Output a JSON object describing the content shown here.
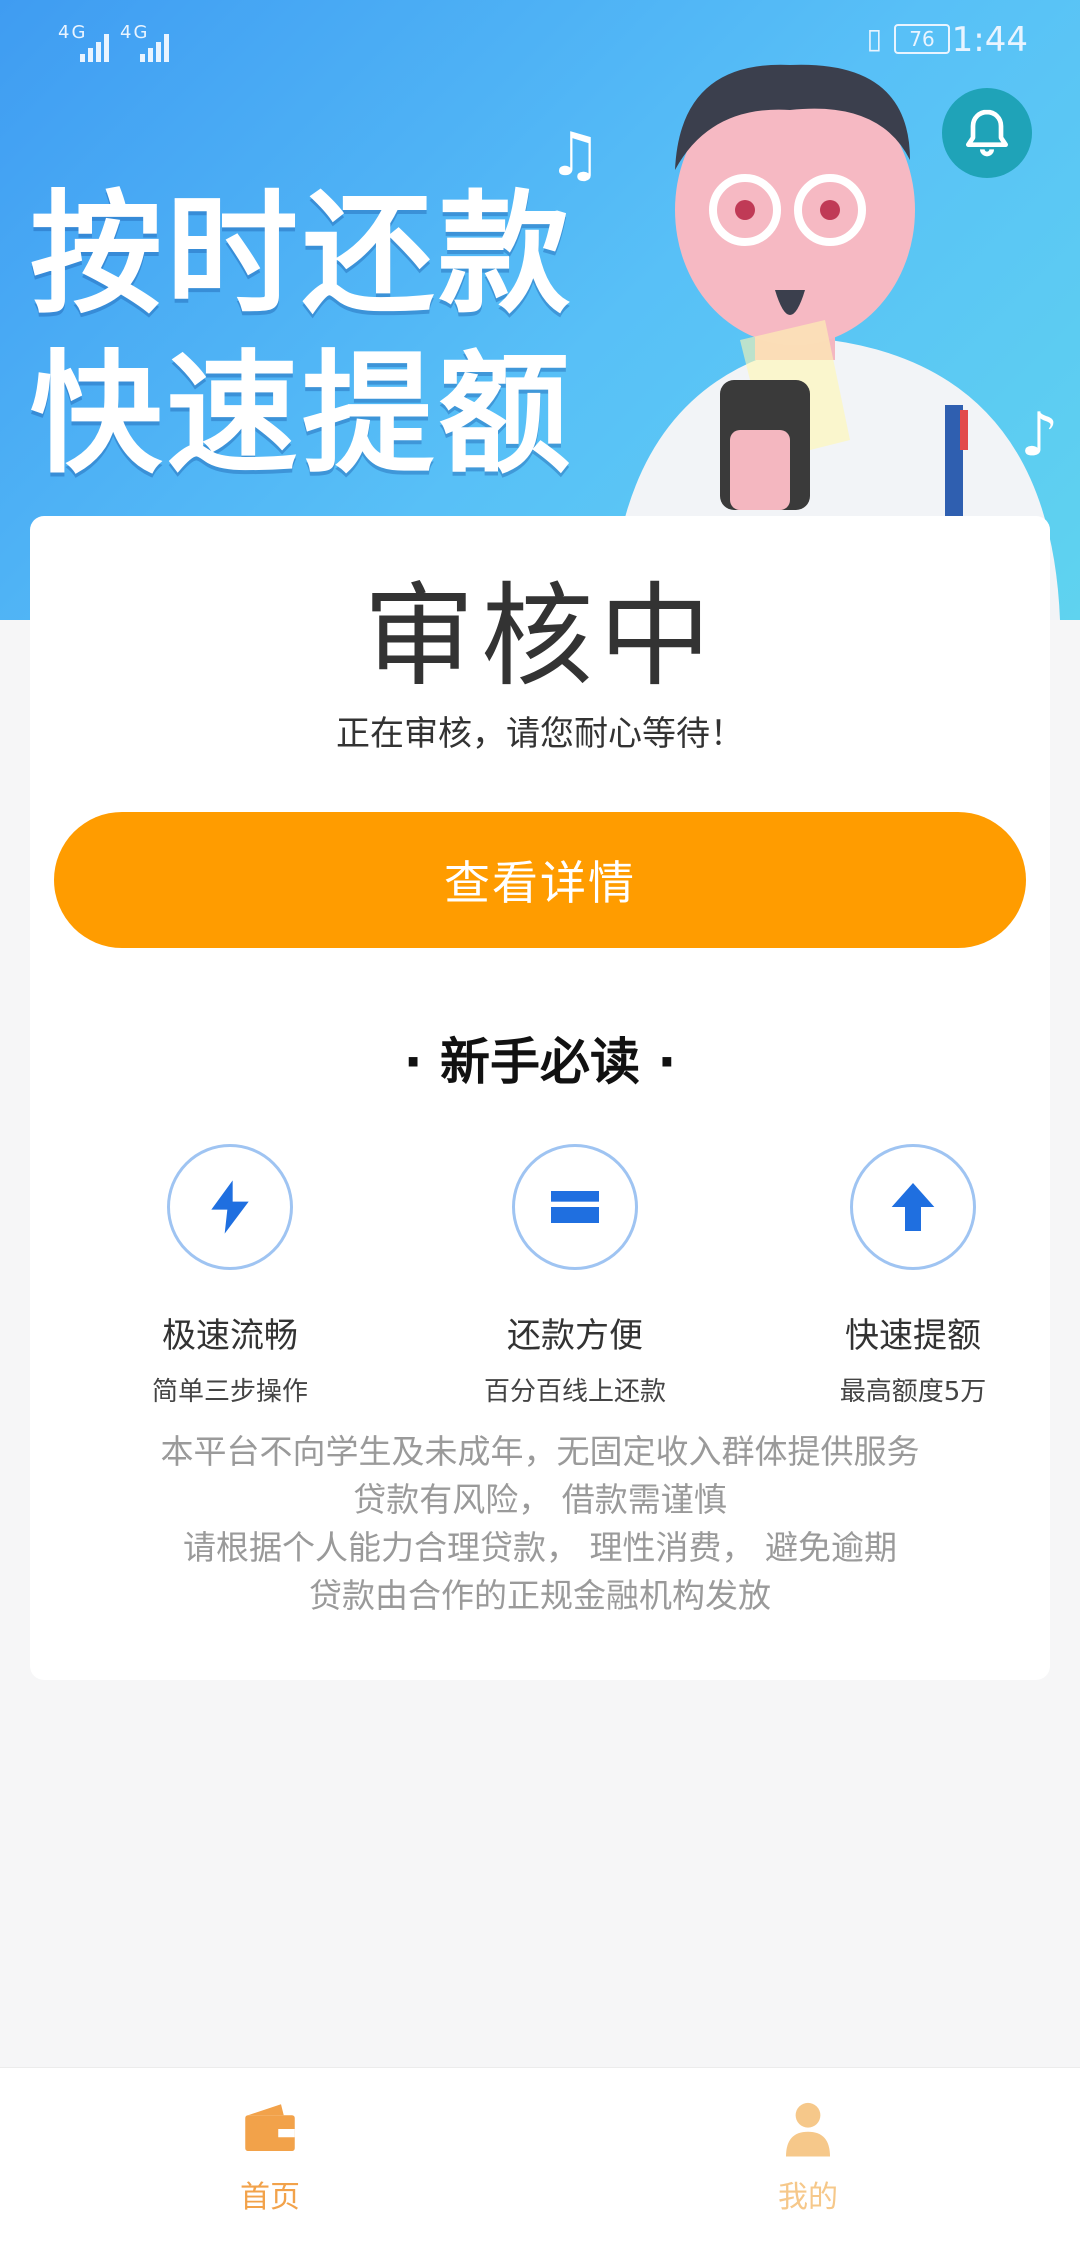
{
  "status_bar": {
    "signal_1": "4G",
    "signal_2": "4G",
    "battery": "76",
    "time": "1:44"
  },
  "banner": {
    "line1": "按时还款",
    "line2": "快速提额"
  },
  "card": {
    "status_title": "审核中",
    "status_subtitle": "正在审核，请您耐心等待！",
    "detail_button": "查看详情",
    "section_title": "· 新手必读 ·",
    "features": [
      {
        "name": "极速流畅",
        "desc": "简单三步操作",
        "icon": "lightning-icon"
      },
      {
        "name": "还款方便",
        "desc": "百分百线上还款",
        "icon": "card-icon"
      },
      {
        "name": "快速提额",
        "desc": "最高额度5万",
        "icon": "arrow-up-icon"
      }
    ],
    "notice_lines": [
      "本平台不向学生及未成年，无固定收入群体提供服务",
      "贷款有风险， 借款需谨慎",
      "请根据个人能力合理贷款， 理性消费， 避免逾期",
      "贷款由合作的正规金融机构发放"
    ]
  },
  "tabbar": {
    "home": "首页",
    "mine": "我的"
  },
  "colors": {
    "accent": "#ff9c00",
    "feature_icon": "#1f6fe0",
    "tab_active": "#f2a24a",
    "tab_inactive": "#f6c88a"
  }
}
